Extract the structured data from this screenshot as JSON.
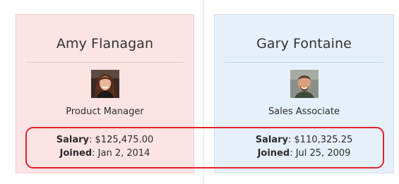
{
  "cards": [
    {
      "name": "Amy Flanagan",
      "avatar_icon": "woman-portrait-photo",
      "title": "Product Manager",
      "salary_label": "Salary",
      "salary_value": ": $125,475.00",
      "joined_label": "Joined",
      "joined_value": ": Jan 2, 2014",
      "background": "#fde4e4"
    },
    {
      "name": "Gary Fontaine",
      "avatar_icon": "man-portrait-photo",
      "title": "Sales Associate",
      "salary_label": "Salary",
      "salary_value": ": $110,325.25",
      "joined_label": "Joined",
      "joined_value": ": Jul 25, 2009",
      "background": "#e5f0fb"
    }
  ],
  "highlight_color": "#e3232b"
}
